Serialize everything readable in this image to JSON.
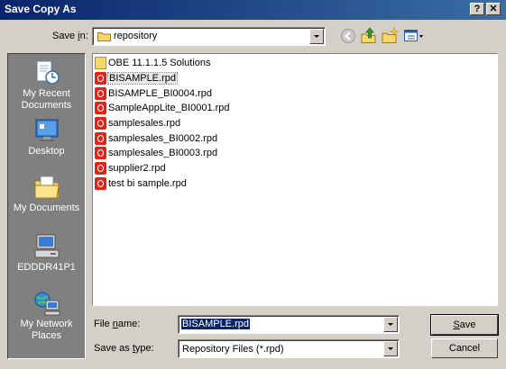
{
  "window": {
    "title": "Save Copy As",
    "help_btn": "?",
    "close_btn": "✕"
  },
  "save_in": {
    "label_pre": "Save ",
    "label_u": "i",
    "label_post": "n:",
    "value": "repository"
  },
  "toolbar": {
    "back": "back-icon",
    "up": "up-folder-icon",
    "new_folder": "new-folder-icon",
    "views": "views-menu-icon"
  },
  "places": [
    {
      "label": "My Recent Documents",
      "icon": "recent-documents-icon"
    },
    {
      "label": "Desktop",
      "icon": "desktop-icon"
    },
    {
      "label": "My Documents",
      "icon": "my-documents-icon"
    },
    {
      "label": "EDDDR41P1",
      "icon": "computer-icon"
    },
    {
      "label": "My Network Places",
      "icon": "network-places-icon"
    }
  ],
  "files": [
    {
      "name": "OBE 11.1.1.5 Solutions",
      "type": "folder"
    },
    {
      "name": "BISAMPLE.rpd",
      "type": "file"
    },
    {
      "name": "BISAMPLE_BI0004.rpd",
      "type": "file"
    },
    {
      "name": "SampleAppLite_BI0001.rpd",
      "type": "file"
    },
    {
      "name": "samplesales.rpd",
      "type": "file"
    },
    {
      "name": "samplesales_BI0002.rpd",
      "type": "file"
    },
    {
      "name": "samplesales_BI0003.rpd",
      "type": "file"
    },
    {
      "name": "supplier2.rpd",
      "type": "file"
    },
    {
      "name": "test bi sample.rpd",
      "type": "file"
    }
  ],
  "filename": {
    "label_pre": "File ",
    "label_u": "n",
    "label_post": "ame:",
    "value": "BISAMPLE.rpd"
  },
  "filetype": {
    "label_pre": "Save as ",
    "label_u": "t",
    "label_post": "ype:",
    "value": "Repository Files (*.rpd)"
  },
  "buttons": {
    "save_u": "S",
    "save_rest": "ave",
    "cancel": "Cancel"
  }
}
